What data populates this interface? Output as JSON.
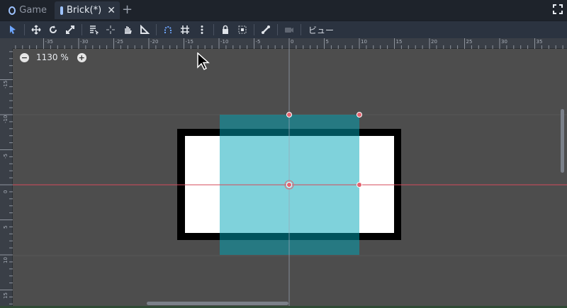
{
  "tabs": [
    {
      "label": "Game",
      "icon": "node-circle-icon"
    },
    {
      "label": "Brick(*)",
      "icon": "scene-square-icon",
      "close": "✕"
    }
  ],
  "add_tab": "+",
  "toolbar": {
    "view_label": "ビュー"
  },
  "ruler": {
    "top_labels": [
      "-35",
      "-30",
      "-25",
      "-20",
      "-15",
      "-10",
      "-5",
      "0",
      "5",
      "10",
      "15",
      "20",
      "25",
      "30",
      "35"
    ],
    "left_labels": [
      "-15",
      "-10",
      "-5",
      "0",
      "5",
      "10",
      "15"
    ]
  },
  "zoom": {
    "minus": "−",
    "value": "1130 %",
    "plus": "+"
  },
  "colors": {
    "brick_border": "#000000",
    "brick_fill": "#ffffff",
    "collision_fill": "#2fb8c9",
    "axis_x": "#d44a5a",
    "handle": "#e5626f"
  }
}
